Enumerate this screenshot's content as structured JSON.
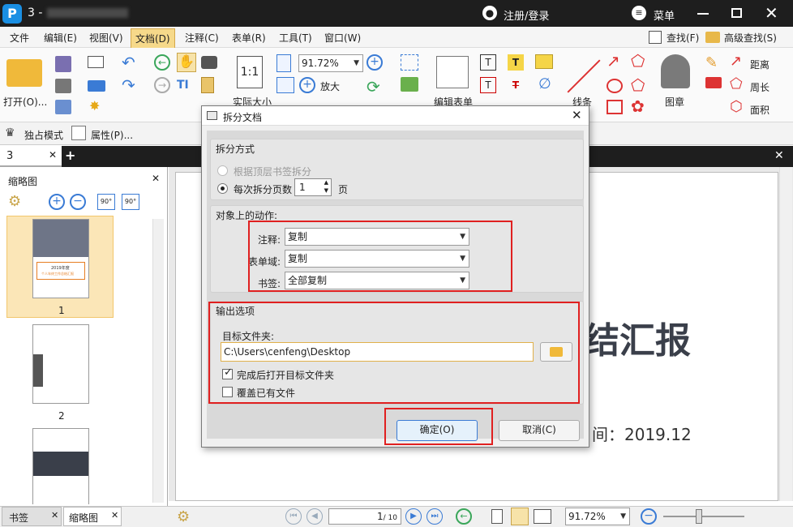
{
  "window": {
    "title": "3 -",
    "login": "注册/登录",
    "menu": "菜单"
  },
  "menubar": [
    "文件",
    "编辑(E)",
    "视图(V)",
    "文档(D)",
    "注释(C)",
    "表单(R)",
    "工具(T)",
    "窗口(W)"
  ],
  "search": {
    "find": "查找(F)",
    "advanced": "高级查找(S)"
  },
  "ribbon": {
    "open": "打开(O)...",
    "zoom": "91.72%",
    "actual_size": "实际大小",
    "enlarge": "放大",
    "edit_form": "编辑表单",
    "line": "线条",
    "stamp": "图章",
    "distance": "距离",
    "perimeter": "周长",
    "area": "面积"
  },
  "toolrow": {
    "exclusive": "独占模式",
    "properties": "属性(P)..."
  },
  "doctab": {
    "name": "3"
  },
  "sidepanel": {
    "title": "缩略图",
    "pages": [
      "1",
      "2"
    ],
    "thumb_title": "2019年度",
    "thumb_sub": "个人年终工作总结汇报"
  },
  "document": {
    "heading_fragment": "结汇报",
    "date_fragment": "间：2019.12"
  },
  "bottom": {
    "tabs": [
      "书签",
      "缩略图"
    ],
    "page": "1",
    "total": "/ 10",
    "zoom": "91.72%"
  },
  "dialog": {
    "title": "拆分文档",
    "split_group": "拆分方式",
    "split_by_bookmark": "根据顶层书签拆分",
    "split_every": "每次拆分页数",
    "pages_value": "1",
    "pages_unit": "页",
    "actions_group": "对象上的动作:",
    "annot_label": "注释:",
    "annot_value": "复制",
    "form_label": "表单域:",
    "form_value": "复制",
    "bookmark_label": "书签:",
    "bookmark_value": "全部复制",
    "output_group": "输出选项",
    "folder_label": "目标文件夹:",
    "folder_value": "C:\\Users\\cenfeng\\Desktop",
    "open_after": "完成后打开目标文件夹",
    "overwrite": "覆盖已有文件",
    "ok": "确定(O)",
    "cancel": "取消(C)"
  },
  "colors": {
    "highlight": "#e02020",
    "accent_tab": "#f6d98a",
    "app_logo": "#1a8fe3"
  }
}
